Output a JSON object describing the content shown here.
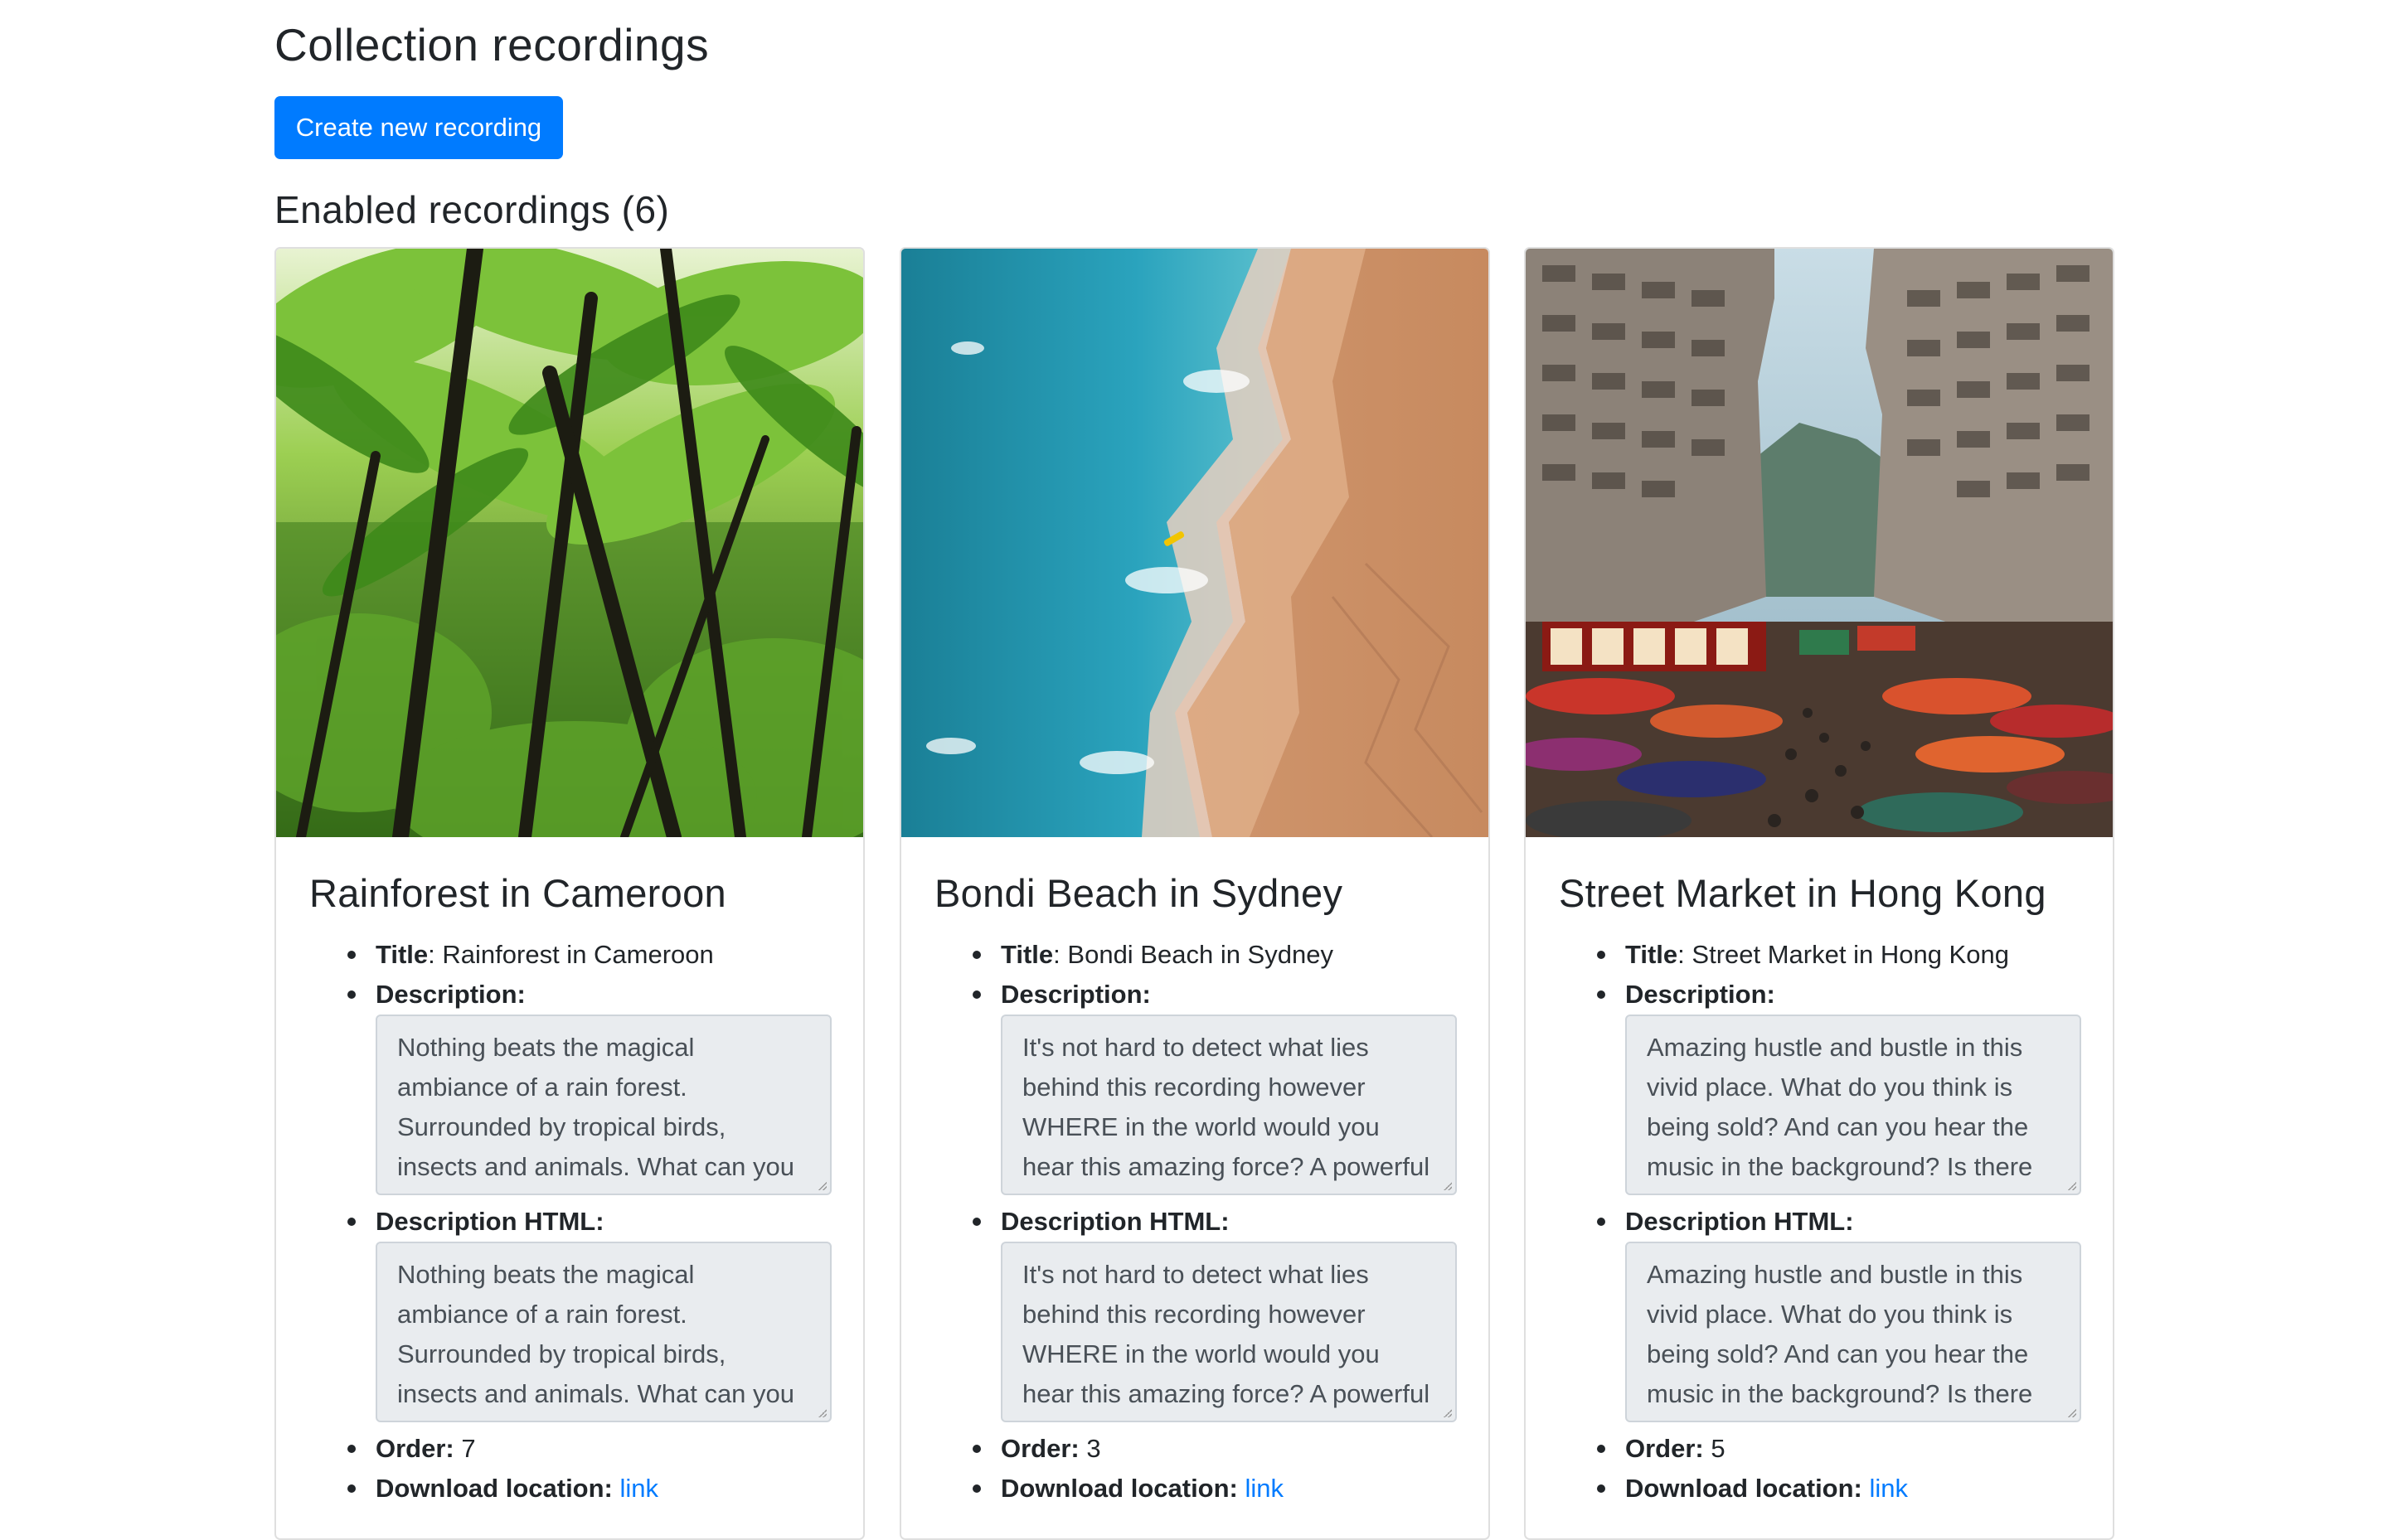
{
  "page": {
    "title": "Collection recordings",
    "create_button": "Create new recording",
    "enabled_heading": "Enabled recordings (6)"
  },
  "labels": {
    "title": "Title",
    "description": "Description:",
    "description_html": "Description HTML:",
    "order": "Order:",
    "download_location": "Download location:",
    "link": "link"
  },
  "cards": [
    {
      "heading": "Rainforest in Cameroon",
      "title": "Rainforest in Cameroon",
      "description": "Nothing beats the magical ambiance of a rain forest. Surrounded by tropical birds, insects and animals. What can you",
      "description_html": "Nothing beats the magical ambiance of a rain forest. Surrounded by tropical birds, insects and animals. What can you",
      "order": "7",
      "image": "rainforest-photo"
    },
    {
      "heading": "Bondi Beach in Sydney",
      "title": "Bondi Beach in Sydney",
      "description": "It's not hard to detect what lies behind this recording however WHERE in the world would you hear this amazing force? A powerful",
      "description_html": "It's not hard to detect what lies behind this recording however WHERE in the world would you hear this amazing force? A powerful",
      "order": "3",
      "image": "beach-aerial-photo"
    },
    {
      "heading": "Street Market in Hong Kong",
      "title": "Street Market in Hong Kong",
      "description": "Amazing hustle and bustle in this vivid place. What do you think is being sold? And can you hear the music in the background? Is there",
      "description_html": "Amazing hustle and bustle in this vivid place. What do you think is being sold? And can you hear the music in the background? Is there",
      "order": "5",
      "image": "street-market-photo"
    }
  ],
  "colors": {
    "primary": "#007bff",
    "text": "#212529",
    "textarea_bg": "#e9ecef"
  }
}
